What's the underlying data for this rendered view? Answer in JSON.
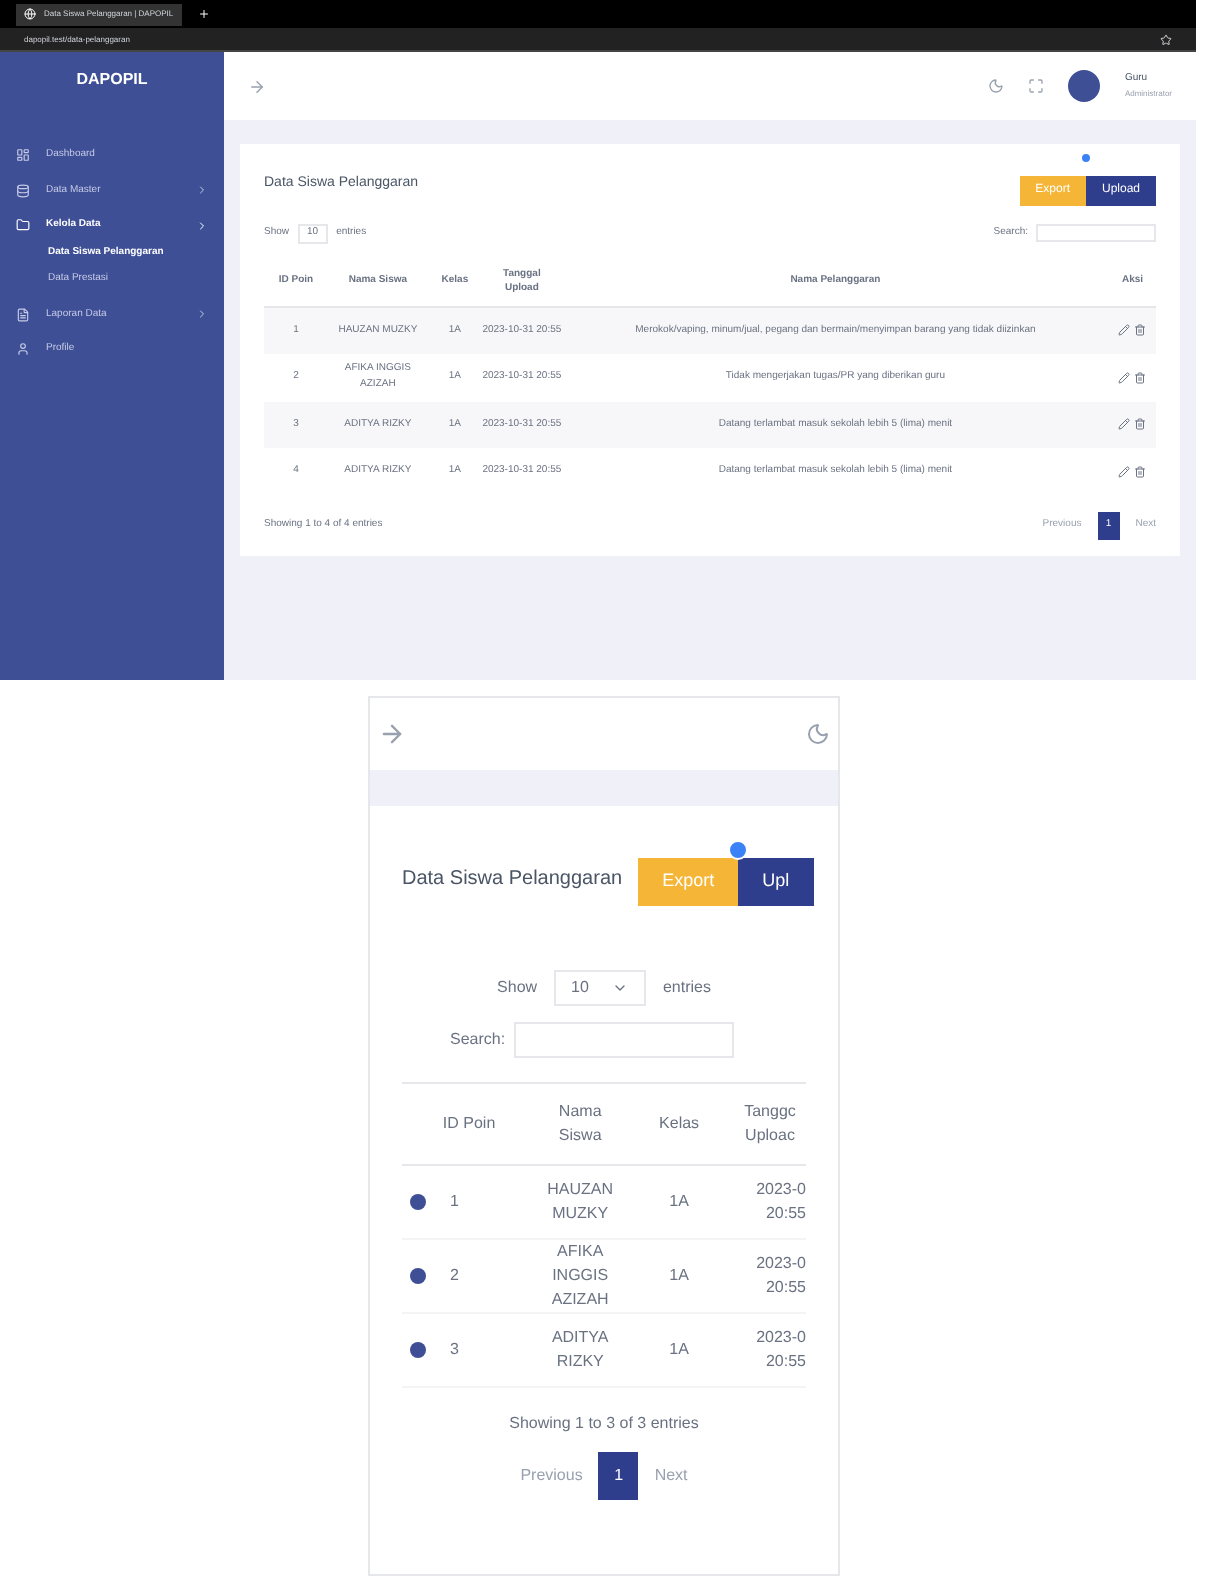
{
  "desktop": {
    "browser": {
      "tab_title": "Data Siswa Pelanggaran | DAPOPIL",
      "url": "dapopil.test/data-pelanggaran"
    },
    "sidebar": {
      "brand": "DAPOPIL",
      "items": [
        {
          "label": "Dashboard",
          "selected": false,
          "expandable": false
        },
        {
          "label": "Data Master",
          "selected": false,
          "expandable": true
        },
        {
          "label": "Kelola Data",
          "selected": true,
          "expandable": true,
          "children": [
            {
              "label": "Data Siswa Pelanggaran",
              "selected": true
            },
            {
              "label": "Data Prestasi",
              "selected": false
            }
          ]
        },
        {
          "label": "Laporan Data",
          "selected": false,
          "expandable": true
        },
        {
          "label": "Profile",
          "selected": false,
          "expandable": false
        }
      ]
    },
    "user": {
      "name": "Guru",
      "role": "Administrator"
    },
    "page_title": "Data Siswa Pelanggaran",
    "buttons": [
      {
        "label": "Export",
        "kind": "warning",
        "badge": false
      },
      {
        "label": "Upload",
        "kind": "primary",
        "badge": true
      }
    ],
    "show": {
      "prefix": "Show",
      "value": "10",
      "suffix": "entries"
    },
    "search_label": "Search:",
    "columns": [
      "ID Poin",
      "Nama Siswa",
      "Kelas",
      "Tanggal Upload",
      "Nama Pelanggaran",
      "Aksi"
    ],
    "rows": [
      {
        "id": "1",
        "name": "HAUZAN MUZKY",
        "kelas": "1A",
        "date": "2023-10-31 20:55",
        "violation": "Merokok/vaping, minum/jual, pegang dan bermain/menyimpan barang yang tidak diizinkan"
      },
      {
        "id": "2",
        "name": "AFIKA INGGIS AZIZAH",
        "kelas": "1A",
        "date": "2023-10-31 20:55",
        "violation": "Tidak mengerjakan tugas/PR yang diberikan guru"
      },
      {
        "id": "3",
        "name": "ADITYA RIZKY",
        "kelas": "1A",
        "date": "2023-10-31 20:55",
        "violation": "Datang terlambat masuk sekolah lebih 5 (lima) menit"
      },
      {
        "id": "4",
        "name": "ADITYA RIZKY",
        "kelas": "1A",
        "date": "2023-10-31 20:55",
        "violation": "Datang terlambat masuk sekolah lebih 5 (lima) menit"
      }
    ],
    "footer": "Showing 1 to 4 of 4 entries",
    "pagination": {
      "previous": "Previous",
      "pages": [
        {
          "label": "1",
          "selected": true
        }
      ],
      "next": "Next"
    }
  },
  "mobile": {
    "page_title": "Data Siswa Pelanggaran",
    "buttons": [
      {
        "label": "Export",
        "kind": "warning",
        "badge": false
      },
      {
        "label": "Upl",
        "kind": "primary",
        "badge": true
      }
    ],
    "show": {
      "prefix": "Show",
      "value": "10",
      "suffix": "entries"
    },
    "search_label": "Search:",
    "columns": [
      "ID Poin",
      "Nama Siswa",
      "Kelas",
      "Tanggc Uploac"
    ],
    "rows": [
      {
        "id": "1",
        "name": "HAUZAN MUZKY",
        "kelas": "1A",
        "date": "2023-0 20:55"
      },
      {
        "id": "2",
        "name": "AFIKA INGGIS AZIZAH",
        "kelas": "1A",
        "date": "2023-0 20:55"
      },
      {
        "id": "3",
        "name": "ADITYA RIZKY",
        "kelas": "1A",
        "date": "2023-0 20:55"
      }
    ],
    "footer": "Showing 1 to 3 of 3 entries",
    "pagination": {
      "previous": "Previous",
      "pages": [
        {
          "label": "1",
          "selected": true
        }
      ],
      "next": "Next"
    }
  }
}
